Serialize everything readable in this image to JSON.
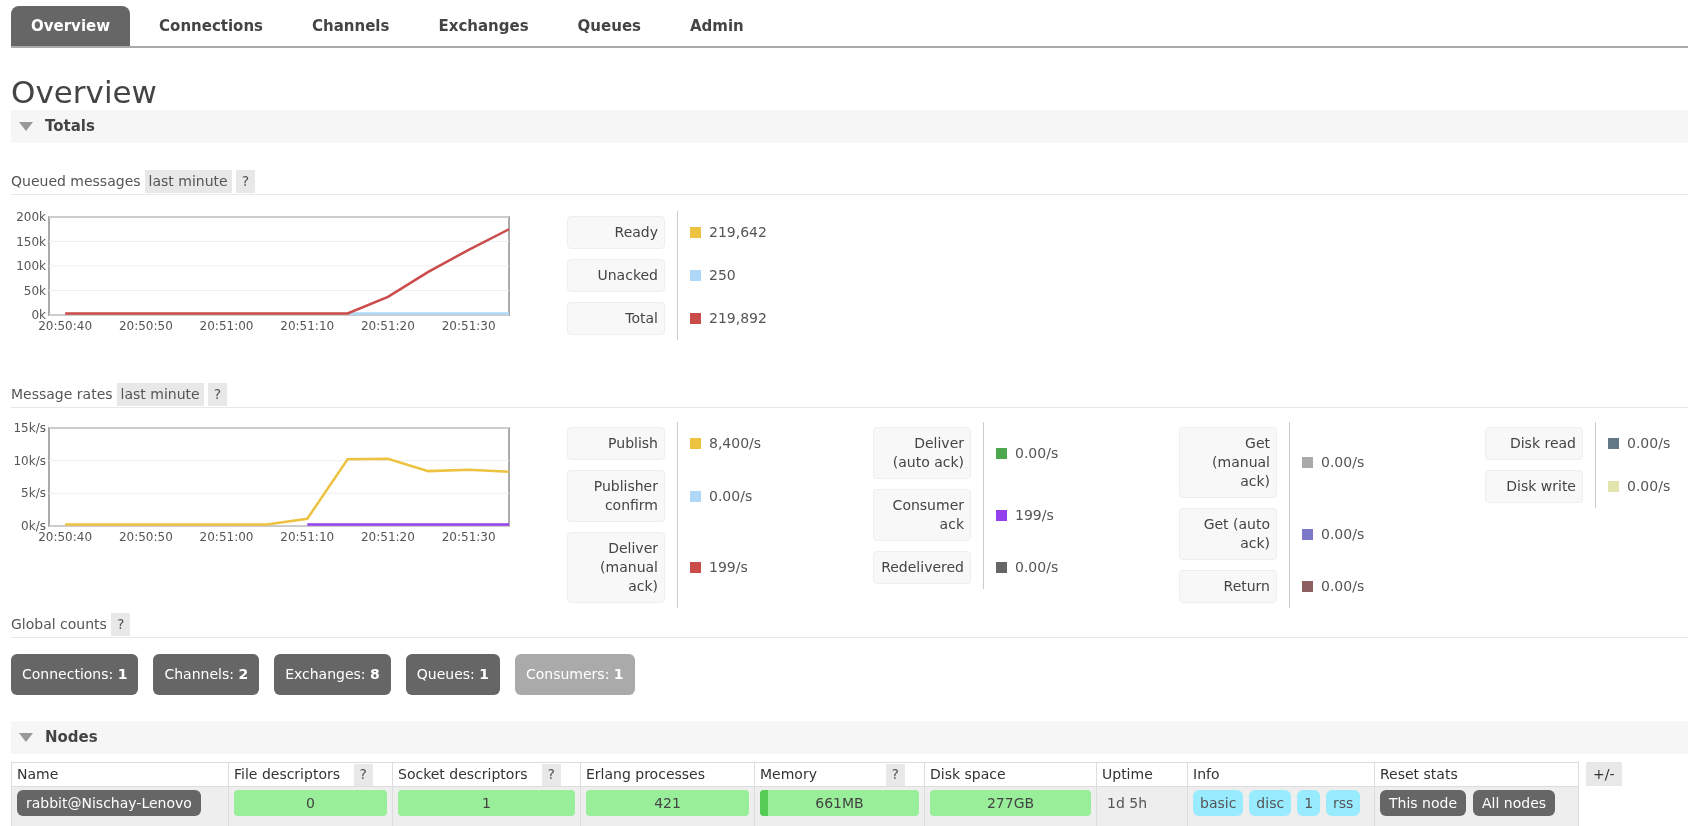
{
  "tabs": [
    {
      "label": "Overview",
      "selected": true
    },
    {
      "label": "Connections",
      "selected": false
    },
    {
      "label": "Channels",
      "selected": false
    },
    {
      "label": "Exchanges",
      "selected": false
    },
    {
      "label": "Queues",
      "selected": false
    },
    {
      "label": "Admin",
      "selected": false
    }
  ],
  "title": "Overview",
  "totals": {
    "heading": "Totals",
    "expanded": true,
    "queued_messages": {
      "title": "Queued messages",
      "range": "last minute",
      "help": "?",
      "chart_data": {
        "type": "line",
        "grid": true,
        "categories": [
          "20:50:40",
          null,
          "20:50:50",
          null,
          "20:51:00",
          null,
          "20:51:10",
          null,
          "20:51:20",
          null,
          "20:51:30",
          null
        ],
        "ylim": [
          0,
          200000
        ],
        "yticks": [
          {
            "value": 0,
            "label": "0k"
          },
          {
            "value": 50000,
            "label": "50k"
          },
          {
            "value": 100000,
            "label": "100k"
          },
          {
            "value": 150000,
            "label": "150k"
          },
          {
            "value": 200000,
            "label": "200k"
          }
        ],
        "series": [
          {
            "color": "#afd8f8",
            "values": [
              null,
              null,
              null,
              null,
              null,
              null,
              null,
              0,
              0,
              0,
              0,
              0
            ]
          },
          {
            "color": "#cb4b4b",
            "values": [
              0,
              0,
              0,
              0,
              0,
              0,
              0,
              0,
              37000,
              88000,
              133000,
              175000
            ]
          }
        ]
      },
      "legend_columns": [
        [
          {
            "label": "Ready",
            "color": "#edc240",
            "value": "219,642"
          },
          {
            "label": "Unacked",
            "color": "#afd8f8",
            "value": "250"
          },
          {
            "label": "Total",
            "color": "#cb4b4b",
            "value": "219,892"
          }
        ]
      ]
    },
    "message_rates": {
      "title": "Message rates",
      "range": "last minute",
      "help": "?",
      "chart_data": {
        "type": "line",
        "grid": true,
        "categories": [
          "20:50:40",
          null,
          "20:50:50",
          null,
          "20:51:00",
          null,
          "20:51:10",
          null,
          "20:51:20",
          null,
          "20:51:30",
          null
        ],
        "ylim": [
          0,
          15000
        ],
        "yticks": [
          {
            "value": 0,
            "label": "0k/s"
          },
          {
            "value": 5000,
            "label": "5k/s"
          },
          {
            "value": 10000,
            "label": "10k/s"
          },
          {
            "value": 15000,
            "label": "15k/s"
          }
        ],
        "series": [
          {
            "color": "#9440ed",
            "values": [
              null,
              null,
              null,
              null,
              null,
              null,
              0,
              0,
              0,
              0,
              0,
              200
            ]
          },
          {
            "color": "#edc240",
            "values": [
              0,
              0,
              0,
              0,
              0,
              0,
              1100,
              10200,
              10300,
              8400,
              8600,
              8300
            ]
          }
        ]
      },
      "legend_columns": [
        [
          {
            "label": "Publish",
            "color": "#edc240",
            "value": "8,400/s"
          },
          {
            "label": "Publisher confirm",
            "color": "#afd8f8",
            "value": "0.00/s"
          },
          {
            "label": "Deliver (manual ack)",
            "color": "#cb4b4b",
            "value": "199/s"
          }
        ],
        [
          {
            "label": "Deliver (auto ack)",
            "color": "#4da74d",
            "value": "0.00/s"
          },
          {
            "label": "Consumer ack",
            "color": "#9440ed",
            "value": "199/s"
          },
          {
            "label": "Redelivered",
            "color": "#666666",
            "value": "0.00/s"
          }
        ],
        [
          {
            "label": "Get (manual ack)",
            "color": "#aaaaaa",
            "value": "0.00/s"
          },
          {
            "label": "Get (auto ack)",
            "color": "#7c79c9",
            "value": "0.00/s"
          },
          {
            "label": "Return",
            "color": "#8d6060",
            "value": "0.00/s"
          }
        ],
        [
          {
            "label": "Disk read",
            "color": "#627985",
            "value": "0.00/s"
          },
          {
            "label": "Disk write",
            "color": "#e3e3ae",
            "value": "0.00/s"
          }
        ]
      ]
    },
    "global_counts": {
      "title": "Global counts",
      "help": "?",
      "counts": [
        {
          "label": "Connections:",
          "value": "1",
          "disabled": false
        },
        {
          "label": "Channels:",
          "value": "2",
          "disabled": false
        },
        {
          "label": "Exchanges:",
          "value": "8",
          "disabled": false
        },
        {
          "label": "Queues:",
          "value": "1",
          "disabled": false
        },
        {
          "label": "Consumers:",
          "value": "1",
          "disabled": true
        }
      ]
    }
  },
  "nodes": {
    "heading": "Nodes",
    "expanded": true,
    "toggle": "+/-",
    "columns": [
      {
        "label": "Name"
      },
      {
        "label": "File descriptors",
        "help": "?"
      },
      {
        "label": "Socket descriptors",
        "help": "?"
      },
      {
        "label": "Erlang processes"
      },
      {
        "label": "Memory",
        "help": "?"
      },
      {
        "label": "Disk space"
      },
      {
        "label": "Uptime"
      },
      {
        "label": "Info"
      },
      {
        "label": "Reset stats"
      }
    ],
    "rows": [
      {
        "name": "rabbit@Nischay-Lenovo",
        "meters": [
          {
            "value": "0",
            "level": 0
          },
          {
            "value": "1",
            "level": 0
          },
          {
            "value": "421",
            "level": 0
          },
          {
            "value": "661MB",
            "level": 0.05
          },
          {
            "value": "277GB",
            "level": 0
          }
        ],
        "uptime": "1d 5h",
        "info": [
          "basic",
          "disc",
          "1",
          "rss"
        ],
        "reset": [
          "This node",
          "All nodes"
        ]
      }
    ]
  }
}
